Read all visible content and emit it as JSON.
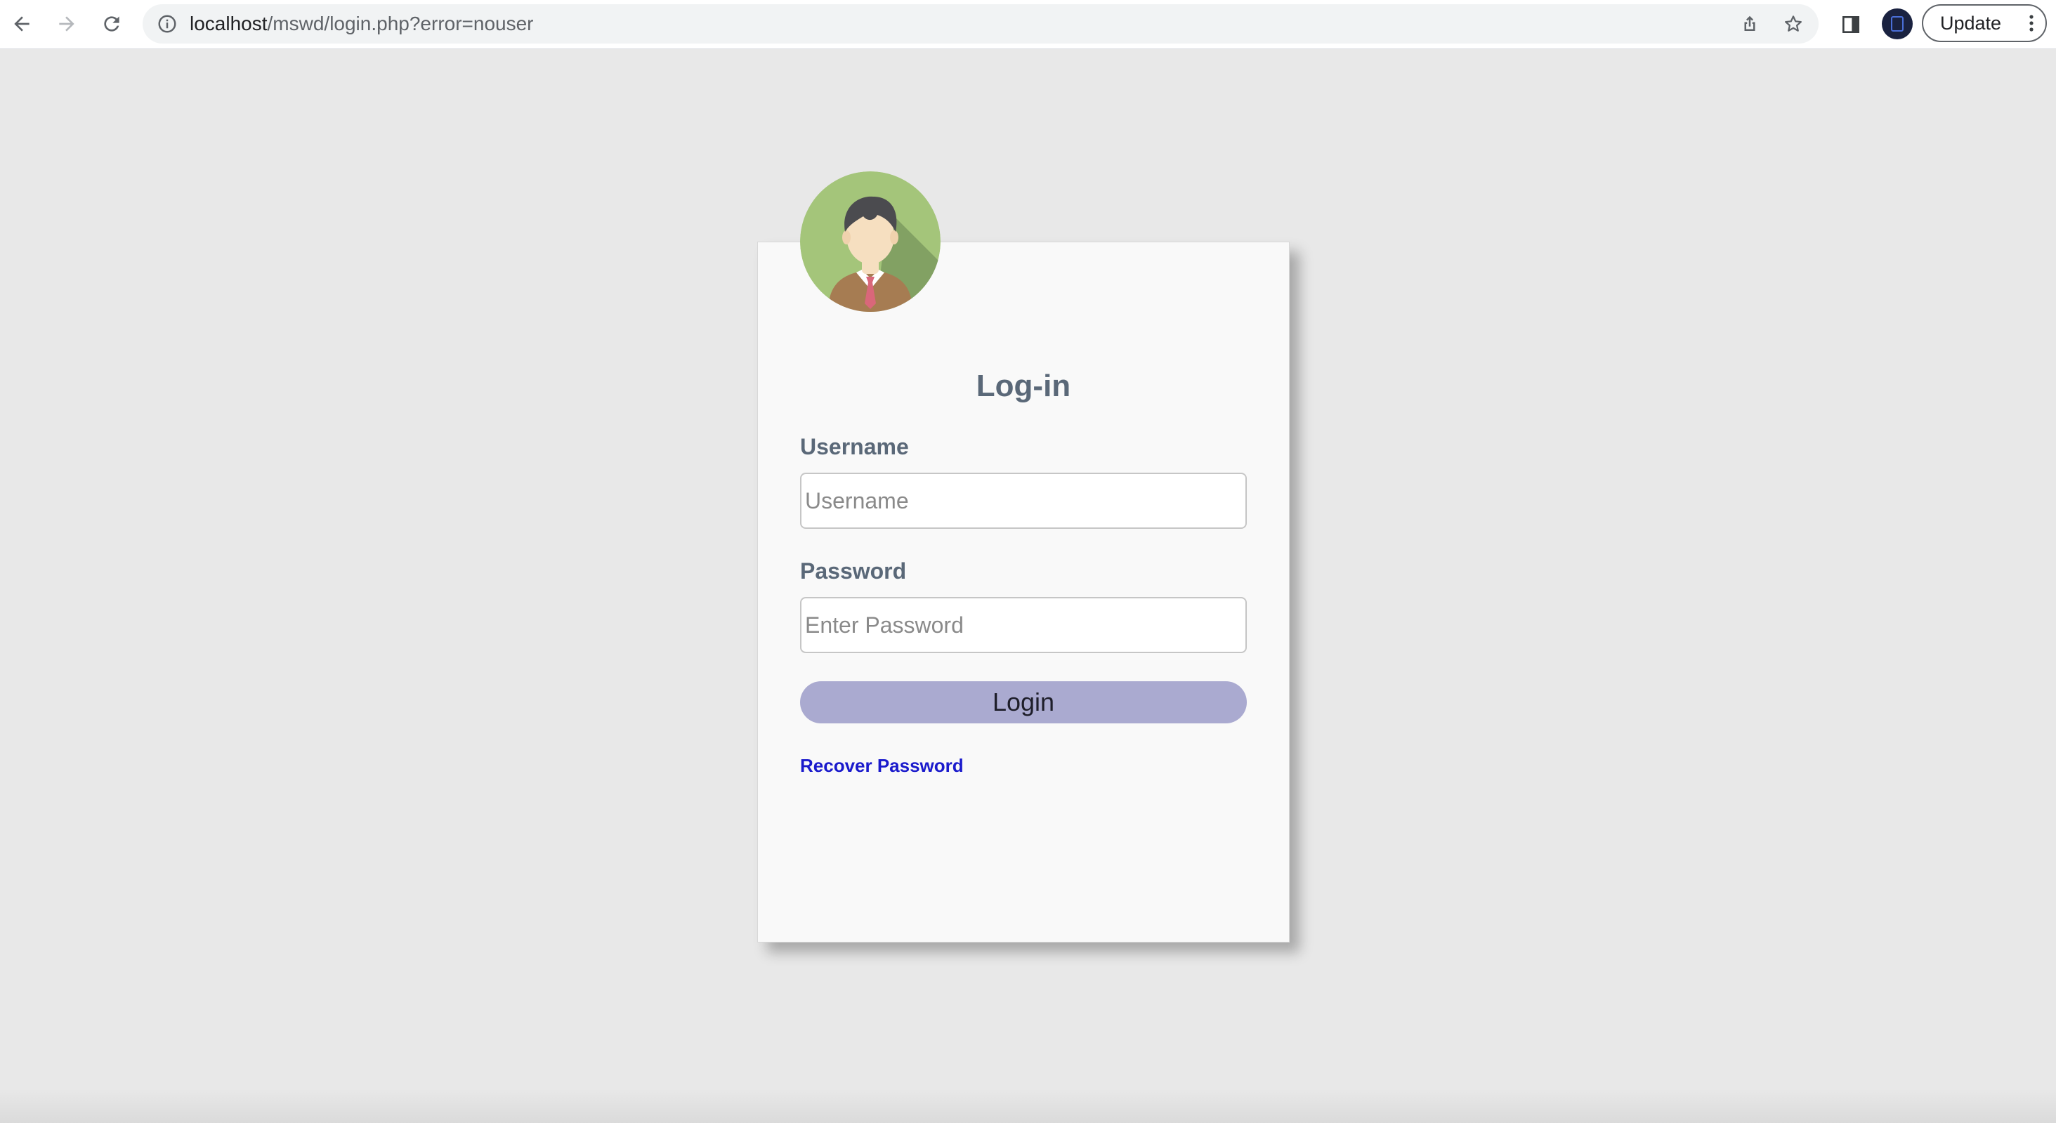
{
  "browser": {
    "url_host": "localhost",
    "url_path": "/mswd/login.php?error=nouser",
    "update_label": "Update",
    "icons": {
      "back": "arrow-left-icon",
      "forward": "arrow-right-icon",
      "reload": "reload-icon",
      "site_info": "info-icon",
      "share": "share-icon",
      "bookmark": "star-icon",
      "side_panel": "side-panel-icon",
      "menu": "kebab-menu-icon"
    }
  },
  "login": {
    "title": "Log-in",
    "username_label": "Username",
    "username_placeholder": "Username",
    "username_value": "",
    "password_label": "Password",
    "password_placeholder": "Enter Password",
    "password_value": "",
    "submit_label": "Login",
    "recover_label": "Recover Password"
  },
  "colors": {
    "page_background": "#e8e8e8",
    "card_background": "#f9f9f9",
    "label_text": "#5a6878",
    "button_background": "#aaaad0",
    "link": "#1a1acc",
    "avatar_background": "#a4c57a"
  }
}
